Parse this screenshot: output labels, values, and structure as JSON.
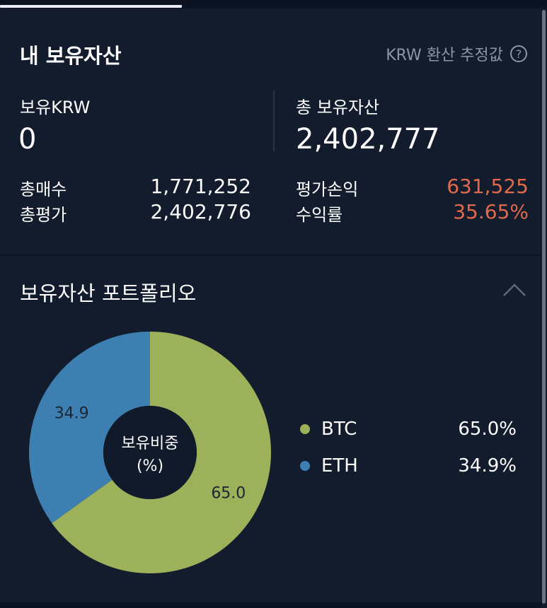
{
  "header": {
    "title": "내 보유자산",
    "conversion_note": "KRW 환산 추정값",
    "help_icon": "?"
  },
  "summary": {
    "krw_label": "보유KRW",
    "krw_value": "0",
    "total_assets_label": "총 보유자산",
    "total_assets_value": "2,402,777",
    "total_buy_label": "총매수",
    "total_buy_value": "1,771,252",
    "total_eval_label": "총평가",
    "total_eval_value": "2,402,776",
    "pnl_label": "평가손익",
    "pnl_value": "631,525",
    "return_label": "수익률",
    "return_value": "35.65%"
  },
  "portfolio": {
    "title": "보유자산 포트폴리오",
    "center_line1": "보유비중",
    "center_line2": "(%)",
    "legend": [
      {
        "name": "BTC",
        "value": "65.0%"
      },
      {
        "name": "ETH",
        "value": "34.9%"
      }
    ]
  },
  "colors": {
    "background": "#121c2d",
    "negative_red": "#e26a4c",
    "btc": "#9db05a",
    "eth": "#3d7fb0"
  },
  "chart_data": {
    "type": "pie",
    "categories": [
      "BTC",
      "ETH"
    ],
    "values": [
      65.0,
      34.9
    ],
    "labels": [
      "65.0",
      "34.9"
    ],
    "colors": [
      "#9db05a",
      "#3d7fb0"
    ]
  }
}
